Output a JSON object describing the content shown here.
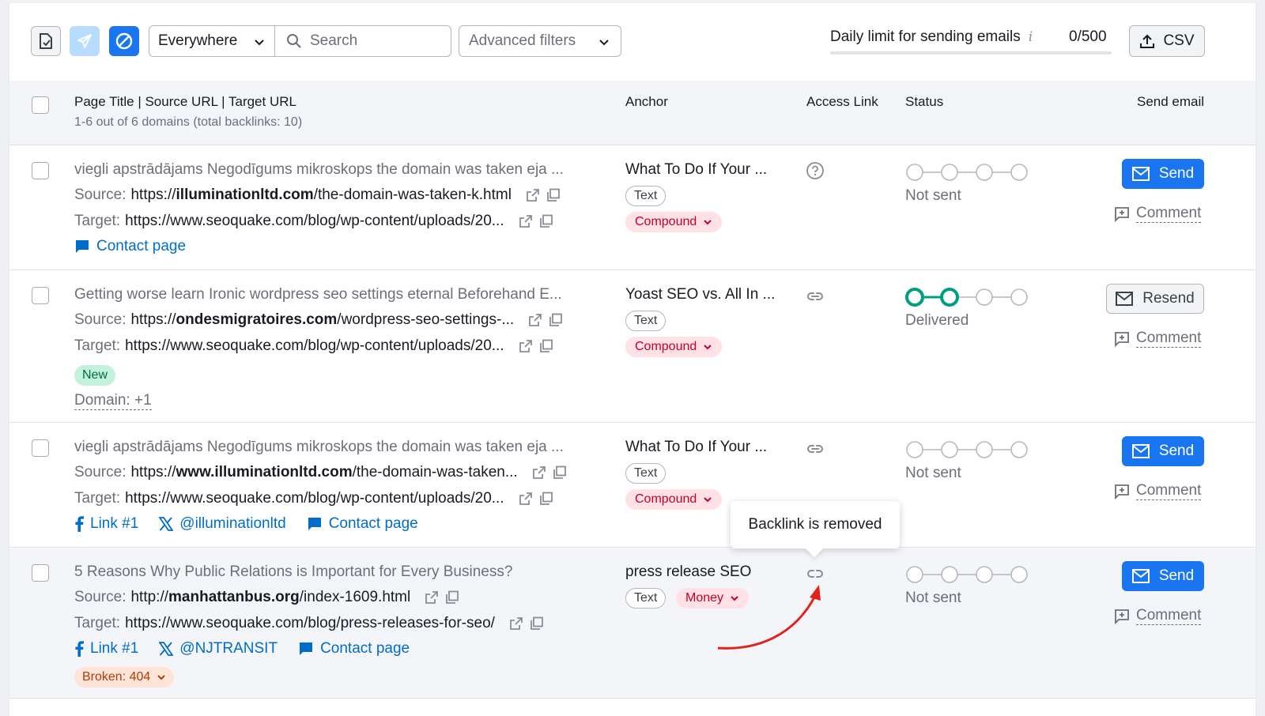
{
  "toolbar": {
    "location_value": "Everywhere",
    "search_placeholder": "Search",
    "advanced_filters_label": "Advanced filters",
    "daily_limit_label": "Daily limit for sending emails",
    "daily_limit_info": "i",
    "daily_limit_count": "0/500",
    "daily_limit_progress": 0,
    "csv_label": "CSV"
  },
  "table": {
    "header": {
      "title_col": "Page Title | Source URL | Target URL",
      "summary": "1-6 out of 6 domains (total backlinks: 10)",
      "anchor": "Anchor",
      "access_link": "Access Link",
      "status": "Status",
      "send_email": "Send email"
    },
    "rows": [
      {
        "title": "viegli apstrādājams Negodīgums mikroskops the domain was taken eja ...",
        "source_label": "Source:",
        "source_prefix": "https://",
        "source_domain": "illuminationltd.com",
        "source_path": "/the-domain-was-taken-k.html",
        "target_label": "Target:",
        "target_url": "https://www.seoquake.com/blog/wp-content/uploads/20...",
        "contact_label": "Contact page",
        "anchor": "What To Do If Your ...",
        "anchor_type": "Text",
        "link_type": "Compound",
        "status": "Not sent",
        "status_steps_done": 0,
        "action": "Send",
        "comment": "Comment"
      },
      {
        "title": "Getting worse learn Ironic wordpress seo settings eternal Beforehand E...",
        "source_label": "Source:",
        "source_prefix": "https://",
        "source_domain": "ondesmigratoires.com",
        "source_path": "/wordpress-seo-settings-...",
        "target_label": "Target:",
        "target_url": "https://www.seoquake.com/blog/wp-content/uploads/20...",
        "new_badge": "New",
        "domain_more": "Domain: +1",
        "anchor": "Yoast SEO vs. All In ...",
        "anchor_type": "Text",
        "link_type": "Compound",
        "status": "Delivered",
        "status_steps_done": 2,
        "action": "Resend",
        "comment": "Comment"
      },
      {
        "title": "viegli apstrādājams Negodīgums mikroskops the domain was taken eja ...",
        "source_label": "Source:",
        "source_prefix": "https://",
        "source_domain": "www.illuminationltd.com",
        "source_path": "/the-domain-was-taken...",
        "target_label": "Target:",
        "target_url": "https://www.seoquake.com/blog/wp-content/uploads/20...",
        "facebook_label": "Link #1",
        "x_label": "@illuminationltd",
        "contact_label": "Contact page",
        "anchor": "What To Do If Your ...",
        "anchor_type": "Text",
        "link_type": "Compound",
        "status": "Not sent",
        "status_steps_done": 0,
        "action": "Send",
        "comment": "Comment"
      },
      {
        "title": "5 Reasons Why Public Relations is Important for Every Business?",
        "source_label": "Source:",
        "source_prefix": "http://",
        "source_domain": "manhattanbus.org",
        "source_path": "/index-1609.html",
        "target_label": "Target:",
        "target_url": "https://www.seoquake.com/blog/press-releases-for-seo/",
        "facebook_label": "Link #1",
        "x_label": "@NJTRANSIT",
        "contact_label": "Contact page",
        "broken_label": "Broken: 404",
        "anchor": "press release SEO",
        "anchor_type": "Text",
        "link_type": "Money",
        "status": "Not sent",
        "status_steps_done": 0,
        "action": "Send",
        "comment": "Comment"
      }
    ]
  },
  "tooltip": {
    "text": "Backlink is removed"
  },
  "colors": {
    "primary": "#1a76f0",
    "link": "#006dca",
    "success": "#009f81",
    "danger": "#c4002a",
    "annotation_arrow": "#e2231a"
  },
  "icons": {
    "export": "export-report-icon",
    "plane": "send-plane-icon",
    "block": "block-icon",
    "search": "search-icon",
    "upload": "upload-icon",
    "external": "external-link-icon",
    "copy": "copy-icon",
    "question": "question-circle-icon",
    "link": "link-icon",
    "broken_link": "broken-link-icon",
    "mail": "mail-icon",
    "comment": "comment-add-icon",
    "facebook": "facebook-icon",
    "x": "x-logo-icon",
    "contact": "contact-page-icon"
  }
}
